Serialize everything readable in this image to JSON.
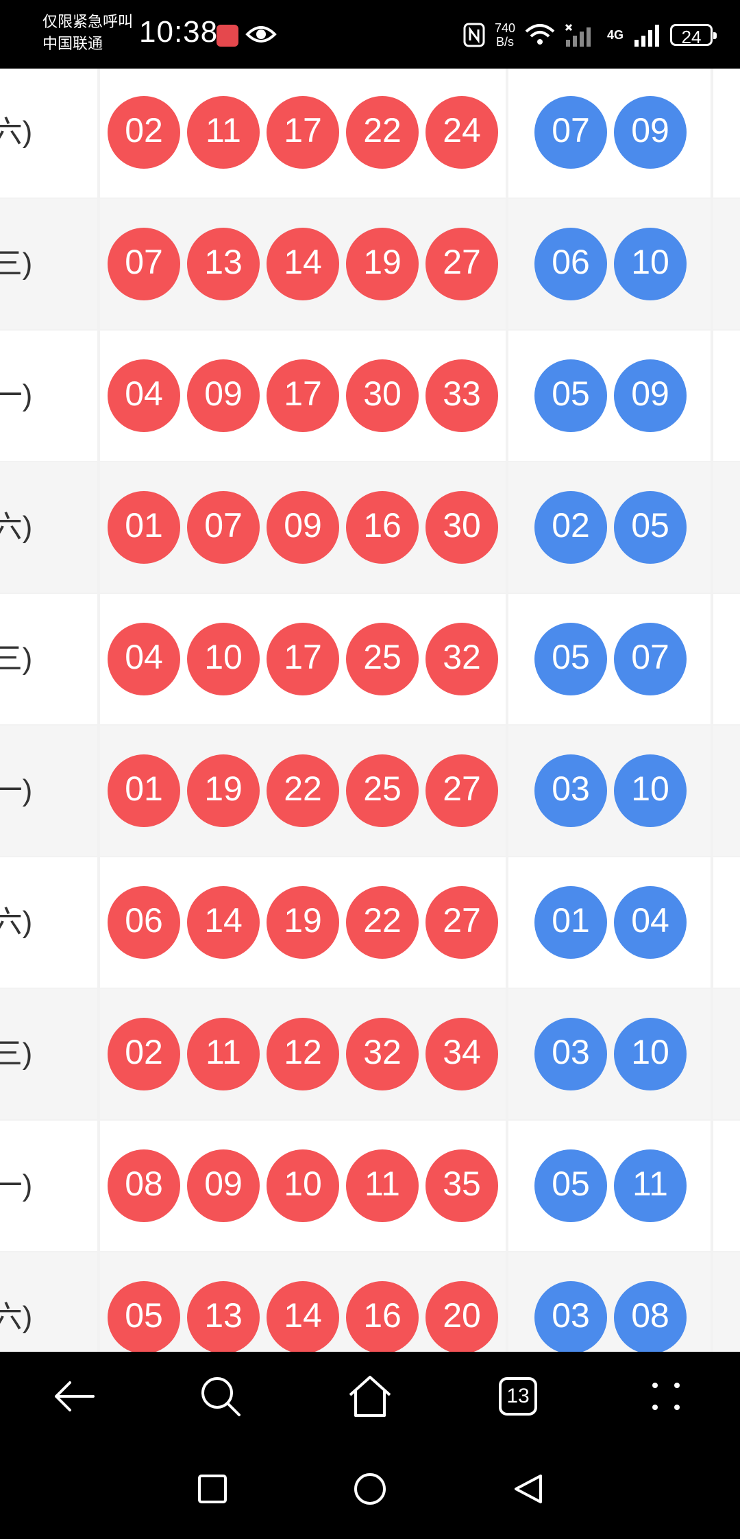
{
  "status_bar": {
    "carrier_line1": "仅限紧急呼叫",
    "carrier_line2": "中国联通",
    "time": "10:38",
    "net_speed_value": "740",
    "net_speed_unit": "B/s",
    "network_type": "4G",
    "battery": "24",
    "icons": [
      "app-notification-icon",
      "eye-icon",
      "nfc-icon",
      "wifi-icon",
      "signal-icon",
      "battery-icon"
    ]
  },
  "draws": [
    {
      "weekday": "(六)",
      "red": [
        "02",
        "11",
        "17",
        "22",
        "24"
      ],
      "blue": [
        "07",
        "09"
      ]
    },
    {
      "weekday": "(三)",
      "red": [
        "07",
        "13",
        "14",
        "19",
        "27"
      ],
      "blue": [
        "06",
        "10"
      ]
    },
    {
      "weekday": "(一)",
      "red": [
        "04",
        "09",
        "17",
        "30",
        "33"
      ],
      "blue": [
        "05",
        "09"
      ]
    },
    {
      "weekday": "(六)",
      "red": [
        "01",
        "07",
        "09",
        "16",
        "30"
      ],
      "blue": [
        "02",
        "05"
      ]
    },
    {
      "weekday": "(三)",
      "red": [
        "04",
        "10",
        "17",
        "25",
        "32"
      ],
      "blue": [
        "05",
        "07"
      ]
    },
    {
      "weekday": "(一)",
      "red": [
        "01",
        "19",
        "22",
        "25",
        "27"
      ],
      "blue": [
        "03",
        "10"
      ]
    },
    {
      "weekday": "(六)",
      "red": [
        "06",
        "14",
        "19",
        "22",
        "27"
      ],
      "blue": [
        "01",
        "04"
      ]
    },
    {
      "weekday": "(三)",
      "red": [
        "02",
        "11",
        "12",
        "32",
        "34"
      ],
      "blue": [
        "03",
        "10"
      ]
    },
    {
      "weekday": "(一)",
      "red": [
        "08",
        "09",
        "10",
        "11",
        "35"
      ],
      "blue": [
        "05",
        "11"
      ]
    },
    {
      "weekday": "(六)",
      "red": [
        "05",
        "13",
        "14",
        "16",
        "20"
      ],
      "blue": [
        "03",
        "08"
      ]
    }
  ],
  "colors": {
    "red_ball": "#f45356",
    "blue_ball": "#4b8bec"
  },
  "browser_nav": {
    "tab_count": "13",
    "icons": [
      "back-arrow-icon",
      "search-icon",
      "home-icon",
      "tabs-icon",
      "menu-dots-icon"
    ]
  },
  "system_nav": {
    "icons": [
      "recent-apps-icon",
      "home-circle-icon",
      "back-triangle-icon"
    ]
  }
}
